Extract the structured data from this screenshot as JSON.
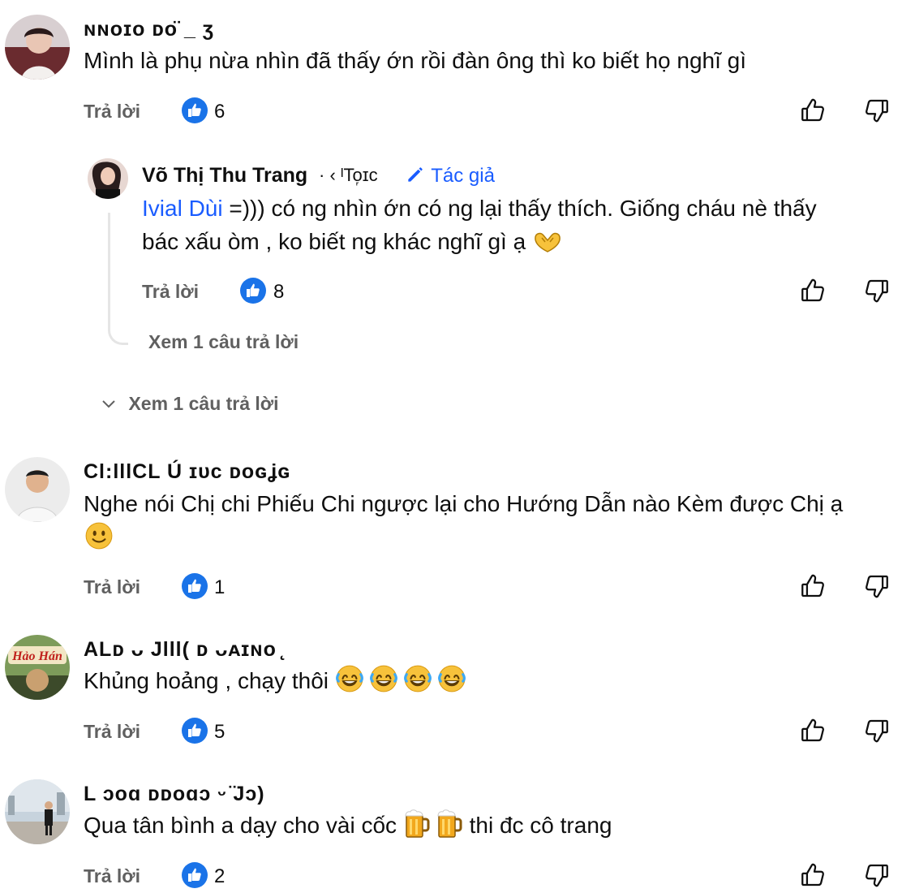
{
  "reply_label": "Trả lời",
  "colors": {
    "like_badge": "#1a73e8",
    "mention": "#1a5cff",
    "muted": "#606060",
    "thread_line": "#e5e5e5"
  },
  "icons": {
    "like": "thumb-up-icon",
    "dislike": "thumb-down-icon",
    "reaction": "like-badge-icon",
    "expand": "chevron-down-icon",
    "author": "pencil-icon"
  },
  "comments": [
    {
      "author": "ɴɴᴏɪᴏ ᴅᴏ̈ _ ʒ",
      "text": "Mình là phụ nừa nhìn đã thấy ớn rồi đàn ông thì ko biết họ nghĩ gì",
      "likes": "6",
      "view_replies": "Xem 1 câu trả lời"
    },
    {
      "author": "Võ Thị Thu Trang",
      "author_suffix": "· ‹ ᴵTo᷊ɪc",
      "author_badge": "Tác giả",
      "mention": "Ivial Dùi",
      "text_line1": "=)))  có ng nhìn ớn có ng lại thấy thích. Giống cháu nè thấy",
      "text_line2": "bác xấu òm , ko biết ng khác nghĩ gì ạ",
      "likes": "8",
      "view_replies": "Xem 1 câu trả lời"
    },
    {
      "author": "Cl:lllCL Ú ɪᴜc ᴅᴏɢʝɢ",
      "text_line1": "Nghe nói Chị chi Phiếu Chi ngược lại cho Hướng Dẫn nào Kèm được Chị ạ",
      "likes": "1"
    },
    {
      "author": "ALᴅ ᴗ Jlll( ᴅ ᴗᴀɪɴᴏ ̨",
      "text": "Khủng hoảng , chạy thôi",
      "likes": "5",
      "avatar_text": "Hảo Hán"
    },
    {
      "author": "L ᴐᴏɑ ᴅᴅᴏɑᴐ ᵕ ̈Jᴐ)",
      "text_before": "Qua tân bình a dạy cho vài cốc",
      "text_after": "thi đc cô trang",
      "likes": "2"
    }
  ]
}
